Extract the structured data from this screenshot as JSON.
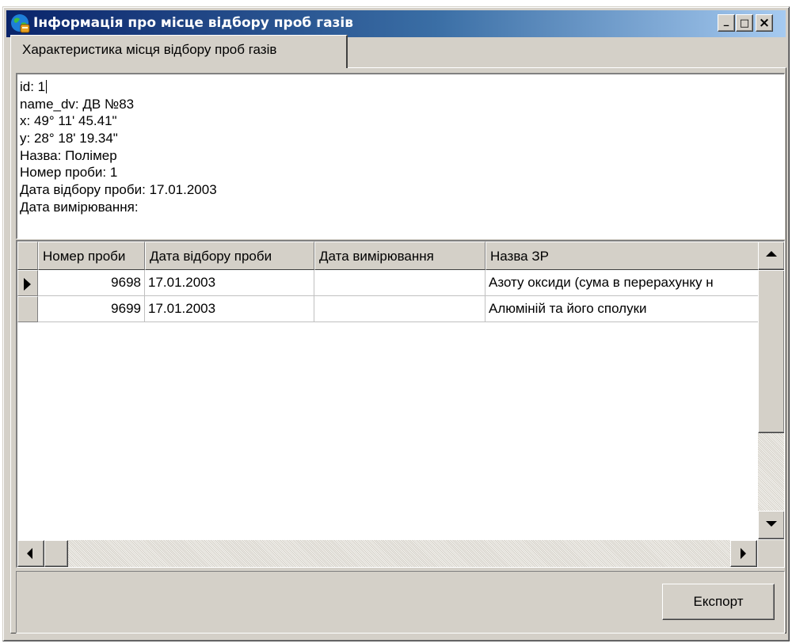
{
  "window": {
    "title": "Інформація про місце відбору проб газів",
    "buttons": {
      "minimize": "_",
      "maximize": "□",
      "close": "×"
    }
  },
  "tabs": [
    {
      "label": "Характеристика місця відбору проб газів",
      "active": true
    }
  ],
  "details": {
    "lines": [
      "id: 1",
      "name_dv: ДВ №83",
      "x: 49° 11' 45.41\"",
      "y: 28° 18' 19.34\"",
      "Назва: Полімер",
      "Номер проби: 1",
      "Дата відбору проби: 17.01.2003",
      "Дата вимірювання:"
    ]
  },
  "table": {
    "columns": [
      "Номер проби",
      "Дата відбору проби",
      "Дата вимірювання",
      "Назва ЗР"
    ],
    "rows": [
      [
        "9698",
        "17.01.2003",
        "",
        "Азоту оксиди (сума в перерахунку н"
      ],
      [
        "9699",
        "17.01.2003",
        "",
        "Алюміній та його сполуки"
      ]
    ],
    "current_row": 0
  },
  "actions": {
    "export_label": "Експорт"
  }
}
